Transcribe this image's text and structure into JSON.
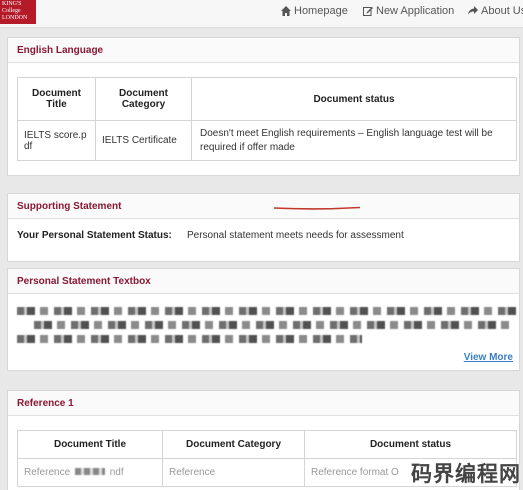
{
  "header": {
    "logo_lines": [
      "KING'S",
      "College",
      "LONDON"
    ],
    "nav": [
      {
        "label": "Homepage",
        "icon": "home-icon"
      },
      {
        "label": "New Application",
        "icon": "edit-icon"
      },
      {
        "label": "About Us",
        "icon": "share-icon"
      }
    ]
  },
  "english": {
    "title": "English Language",
    "columns": [
      "Document Title",
      "Document Category",
      "Document status"
    ],
    "row": {
      "title": "IELTS score.pdf",
      "category": "IELTS Certificate",
      "status": "Doesn't meet English requirements – English language test will be required if offer made"
    }
  },
  "supporting": {
    "title": "Supporting Statement",
    "status_label": "Your Personal Statement Status:",
    "status_value": "Personal statement meets needs for assessment"
  },
  "textbox": {
    "title": "Personal Statement Textbox",
    "view_more": "View More"
  },
  "reference": {
    "title": "Reference 1",
    "columns": [
      "Document Title",
      "Document Category",
      "Document status"
    ],
    "row": {
      "title": "Reference",
      "title_suffix": "ndf",
      "category": "Reference",
      "status": "Reference format O"
    }
  },
  "watermark": "码界编程网",
  "colors": {
    "brand": "#b51a29",
    "heading": "#8a1733",
    "link": "#3a7fc4",
    "annotation": "#c0392b"
  }
}
